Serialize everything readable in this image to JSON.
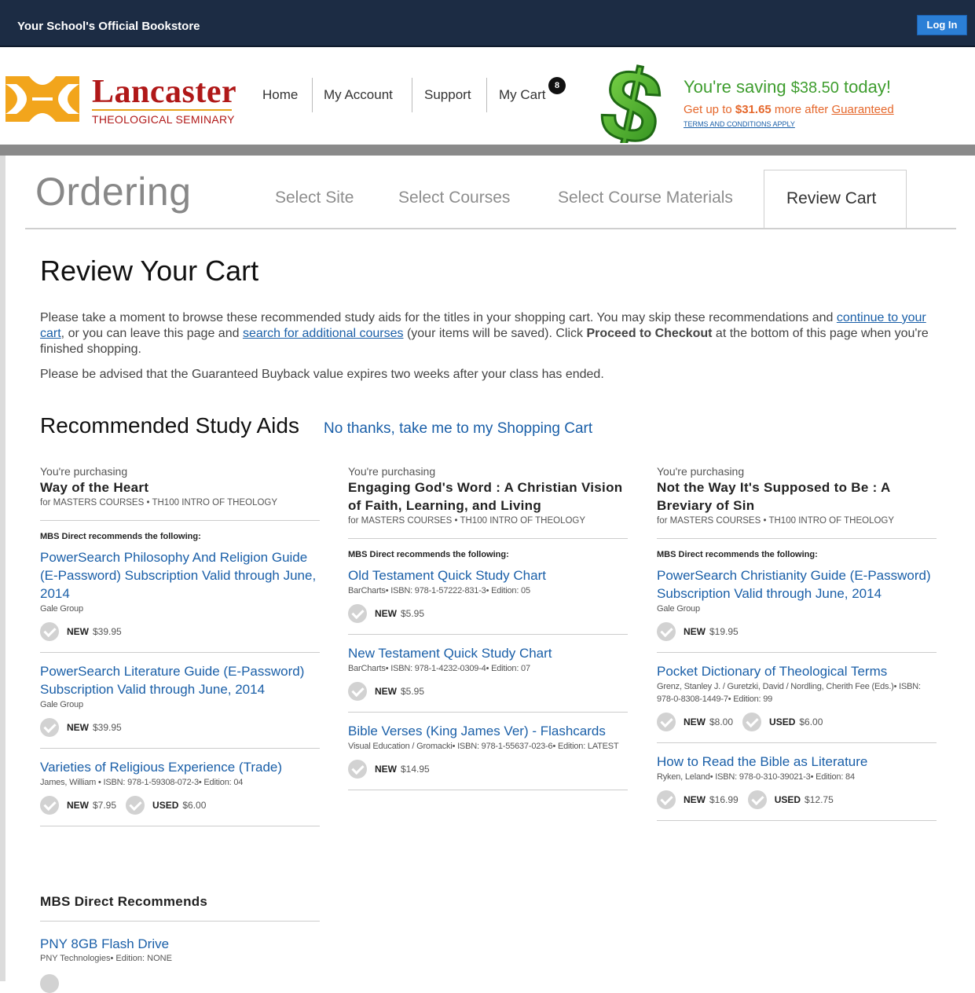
{
  "topbar": {
    "title": "Your School's Official Bookstore",
    "login": "Log In"
  },
  "logo": {
    "name": "Lancaster",
    "sub": "THEOLOGICAL SEMINARY"
  },
  "nav": {
    "home": "Home",
    "account": "My Account",
    "support": "Support",
    "cart": "My Cart",
    "cart_count": "8"
  },
  "savings": {
    "prefix": "You're saving ",
    "amount": "$38.50",
    "suffix": " today!",
    "getup_prefix": "Get up to ",
    "getup_amount": "$31.65",
    "getup_mid": " more after ",
    "getup_link": "Guaranteed",
    "terms": "TERMS AND CONDITIONS APPLY"
  },
  "ordering": {
    "title": "Ordering",
    "tabs": [
      "Select Site",
      "Select Courses",
      "Select Course Materials",
      "Review Cart"
    ],
    "active_tab": "Review Cart"
  },
  "page": {
    "title": "Review Your Cart",
    "intro_1": "Please take a moment to browse these recommended study aids for the titles in your shopping cart. You may skip these recommendations and ",
    "intro_link1": "continue to your cart",
    "intro_2": ", or you can leave this page and ",
    "intro_link2": "search for additional courses",
    "intro_3": " (your items will be saved). Click ",
    "intro_bold": "Proceed to Checkout",
    "intro_4": " at the bottom of this page when you're finished shopping.",
    "advised": "Please be advised that the Guaranteed Buyback value expires two weeks after your class has ended."
  },
  "recommended": {
    "title": "Recommended Study Aids",
    "skip_link": "No thanks, take me to my Shopping Cart",
    "purchasing_label": "You're purchasing",
    "recs_label": "MBS Direct recommends the following:",
    "new_label": "NEW",
    "used_label": "USED",
    "columns": [
      {
        "title": "Way of the Heart",
        "course": "for MASTERS COURSES • TH100 INTRO OF THEOLOGY",
        "items": [
          {
            "name": "PowerSearch Philosophy And Religion Guide (E-Password) Subscription Valid through June, 2014",
            "meta": "Gale Group",
            "new": "$39.95",
            "used": ""
          },
          {
            "name": "PowerSearch Literature Guide (E-Password) Subscription Valid through June, 2014",
            "meta": "Gale Group",
            "new": "$39.95",
            "used": ""
          },
          {
            "name": "Varieties of Religious Experience (Trade)",
            "meta": "James, William • ISBN: 978-1-59308-072-3• Edition: 04",
            "new": "$7.95",
            "used": "$6.00"
          }
        ]
      },
      {
        "title": "Engaging God's Word : A Christian Vision of Faith, Learning, and Living",
        "course": "for MASTERS COURSES • TH100 INTRO OF THEOLOGY",
        "items": [
          {
            "name": "Old Testament Quick Study Chart",
            "meta": "BarCharts• ISBN: 978-1-57222-831-3• Edition: 05",
            "new": "$5.95",
            "used": ""
          },
          {
            "name": "New Testament Quick Study Chart",
            "meta": "BarCharts• ISBN: 978-1-4232-0309-4• Edition: 07",
            "new": "$5.95",
            "used": ""
          },
          {
            "name": "Bible Verses (King James Ver) - Flashcards",
            "meta": "Visual Education / Gromacki• ISBN: 978-1-55637-023-6• Edition: LATEST",
            "new": "$14.95",
            "used": ""
          }
        ]
      },
      {
        "title": "Not the Way It's Supposed to Be : A Breviary of Sin",
        "course": "for MASTERS COURSES • TH100 INTRO OF THEOLOGY",
        "items": [
          {
            "name": "PowerSearch Christianity Guide (E-Password) Subscription Valid through June, 2014",
            "meta": "Gale Group",
            "new": "$19.95",
            "used": ""
          },
          {
            "name": "Pocket Dictionary of Theological Terms",
            "meta": "Grenz, Stanley J. / Guretzki, David / Nordling, Cherith Fee (Eds.)• ISBN: 978-0-8308-1449-7• Edition: 99",
            "new": "$8.00",
            "used": "$6.00"
          },
          {
            "name": "How to Read the Bible as Literature",
            "meta": "Ryken, Leland• ISBN: 978-0-310-39021-3• Edition: 84",
            "new": "$16.99",
            "used": "$12.75"
          }
        ]
      }
    ]
  },
  "mbs": {
    "title": "MBS Direct Recommends",
    "item_name": "PNY 8GB Flash Drive",
    "item_meta": "PNY Technologies• Edition: NONE"
  }
}
